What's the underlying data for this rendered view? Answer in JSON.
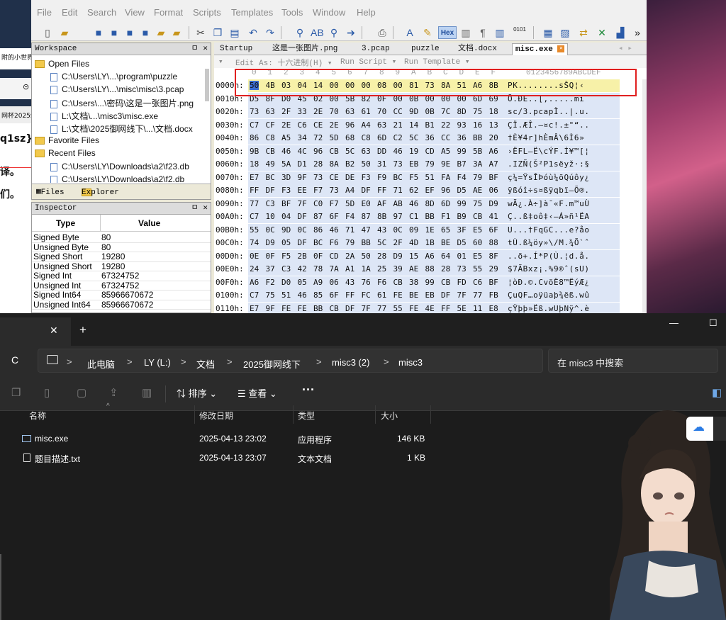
{
  "left_strip": {
    "frag1": "附的小世界",
    "frag2": "网杯2025线",
    "frag3": "q1sz}",
    "frag4": "译。",
    "frag5": "们。"
  },
  "editor": {
    "menu": [
      "File",
      "Edit",
      "Search",
      "View",
      "Format",
      "Scripts",
      "Templates",
      "Tools",
      "Window",
      "Help"
    ],
    "hex_label": "Hex",
    "bin_label": "0101",
    "more": "»",
    "workspace": {
      "title": "Workspace",
      "ctrl": "ㅁ ✕",
      "open_files": "Open Files",
      "files": [
        "C:\\Users\\LY\\...\\program\\puzzle",
        "C:\\Users\\LY\\...\\misc\\misc\\3.pcap",
        "C:\\Users\\...\\密码\\这是一张图片.png",
        "L:\\文档\\...\\misc3\\misc.exe",
        "L:\\文档\\2025御网线下\\...\\文档.docx"
      ],
      "favorites": "Favorite Files",
      "recent": "Recent Files",
      "recent_files": [
        "C:\\Users\\LY\\Downloads\\a2\\f23.db",
        "C:\\Users\\LY\\Downloads\\a2\\f2.db"
      ],
      "tab_files": "Files",
      "tab_explorer": "Explorer"
    },
    "inspector": {
      "title": "Inspector",
      "ctrl": "ㅁ ✕",
      "col_type": "Type",
      "col_value": "Value",
      "rows": [
        {
          "type": "Signed Byte",
          "value": "80"
        },
        {
          "type": "Unsigned Byte",
          "value": "80"
        },
        {
          "type": "Signed Short",
          "value": "19280"
        },
        {
          "type": "Unsigned Short",
          "value": "19280"
        },
        {
          "type": "Signed Int",
          "value": "67324752"
        },
        {
          "type": "Unsigned Int",
          "value": "67324752"
        },
        {
          "type": "Signed Int64",
          "value": "85966670672"
        },
        {
          "type": "Unsigned Int64",
          "value": "85966670672"
        }
      ]
    },
    "tabs": [
      {
        "label": "Startup",
        "active": false
      },
      {
        "label": "这是一张图片.png",
        "active": false
      },
      {
        "label": "3.pcap",
        "active": false
      },
      {
        "label": "puzzle",
        "active": false
      },
      {
        "label": "文档.docx",
        "active": false
      },
      {
        "label": "misc.exe",
        "active": true
      }
    ],
    "edit_as": "Edit As: 十六进制(H) ▾",
    "run_script": "Run Script ▾",
    "run_template": "Run Template ▾",
    "col_headers": [
      "0",
      "1",
      "2",
      "3",
      "4",
      "5",
      "6",
      "7",
      "8",
      "9",
      "A",
      "B",
      "C",
      "D",
      "E",
      "F"
    ],
    "ascii_header": "0123456789ABCDEF",
    "rows": [
      {
        "off": "0000h:",
        "bytes": [
          "50",
          "4B",
          "03",
          "04",
          "14",
          "00",
          "00",
          "00",
          "08",
          "00",
          "81",
          "73",
          "8A",
          "51",
          "A6",
          "8B"
        ],
        "ascii": "PK........sŠQ¦‹"
      },
      {
        "off": "0010h:",
        "bytes": [
          "D5",
          "8F",
          "D0",
          "45",
          "02",
          "00",
          "5B",
          "82",
          "0F",
          "00",
          "0B",
          "00",
          "00",
          "00",
          "6D",
          "69"
        ],
        "ascii": "Õ.ÐE..[‚.....mi"
      },
      {
        "off": "0020h:",
        "bytes": [
          "73",
          "63",
          "2F",
          "33",
          "2E",
          "70",
          "63",
          "61",
          "70",
          "CC",
          "9D",
          "0B",
          "7C",
          "8D",
          "75",
          "18"
        ],
        "ascii": "sc/3.pcapÌ..|.u."
      },
      {
        "off": "0030h:",
        "bytes": [
          "C7",
          "CF",
          "2E",
          "C6",
          "CE",
          "2E",
          "96",
          "A4",
          "63",
          "21",
          "14",
          "B1",
          "22",
          "93",
          "16",
          "13"
        ],
        "ascii": "ÇÏ.ÆÎ.–¤c!.±\"“.."
      },
      {
        "off": "0040h:",
        "bytes": [
          "86",
          "C8",
          "A5",
          "34",
          "72",
          "5D",
          "68",
          "C8",
          "6D",
          "C2",
          "5C",
          "36",
          "CC",
          "36",
          "BB",
          "20"
        ],
        "ascii": "†È¥4r]hÈmÂ\\6Ì6» "
      },
      {
        "off": "0050h:",
        "bytes": [
          "9B",
          "CB",
          "46",
          "4C",
          "96",
          "CB",
          "5C",
          "63",
          "DD",
          "46",
          "19",
          "CD",
          "A5",
          "99",
          "5B",
          "A6"
        ],
        "ascii": "›ËFL–Ë\\cÝF.Í¥™[¦"
      },
      {
        "off": "0060h:",
        "bytes": [
          "18",
          "49",
          "5A",
          "D1",
          "28",
          "8A",
          "B2",
          "50",
          "31",
          "73",
          "EB",
          "79",
          "9E",
          "B7",
          "3A",
          "A7"
        ],
        "ascii": ".IZÑ(Š²P1sëyž·:§"
      },
      {
        "off": "0070h:",
        "bytes": [
          "E7",
          "BC",
          "3D",
          "9F",
          "73",
          "CE",
          "DE",
          "F3",
          "F9",
          "BC",
          "F5",
          "51",
          "FA",
          "F4",
          "79",
          "BF"
        ],
        "ascii": "ç¼=ŸsÎÞóù¼õQúôy¿"
      },
      {
        "off": "0080h:",
        "bytes": [
          "FF",
          "DF",
          "F3",
          "EE",
          "F7",
          "73",
          "A4",
          "DF",
          "FF",
          "71",
          "62",
          "EF",
          "96",
          "D5",
          "AE",
          "06"
        ],
        "ascii": "ÿßóî÷s¤ßÿqbï–Õ®."
      },
      {
        "off": "0090h:",
        "bytes": [
          "77",
          "C3",
          "BF",
          "7F",
          "C0",
          "F7",
          "5D",
          "E0",
          "AF",
          "AB",
          "46",
          "8D",
          "6D",
          "99",
          "75",
          "D9"
        ],
        "ascii": "wÃ¿.À÷]à¯«F.m™uÙ"
      },
      {
        "off": "00A0h:",
        "bytes": [
          "C7",
          "10",
          "04",
          "DF",
          "87",
          "6F",
          "F4",
          "87",
          "8B",
          "97",
          "C1",
          "BB",
          "F1",
          "B9",
          "CB",
          "41"
        ],
        "ascii": "Ç..ß‡oô‡‹—Á»ñ¹ËA"
      },
      {
        "off": "00B0h:",
        "bytes": [
          "55",
          "0C",
          "9D",
          "0C",
          "86",
          "46",
          "71",
          "47",
          "43",
          "0C",
          "09",
          "1E",
          "65",
          "3F",
          "E5",
          "6F"
        ],
        "ascii": "U...†FqGC...e?åo"
      },
      {
        "off": "00C0h:",
        "bytes": [
          "74",
          "D9",
          "05",
          "DF",
          "BC",
          "F6",
          "79",
          "BB",
          "5C",
          "2F",
          "4D",
          "1B",
          "BE",
          "D5",
          "60",
          "88"
        ],
        "ascii": "tÙ.ß¼öy»\\/M.¾Õ`ˆ"
      },
      {
        "off": "00D0h:",
        "bytes": [
          "0E",
          "0F",
          "F5",
          "2B",
          "0F",
          "CD",
          "2A",
          "50",
          "28",
          "D9",
          "15",
          "A6",
          "64",
          "01",
          "E5",
          "8F"
        ],
        "ascii": "..õ+.Í*P(Ù.¦d.å."
      },
      {
        "off": "00E0h:",
        "bytes": [
          "24",
          "37",
          "C3",
          "42",
          "78",
          "7A",
          "A1",
          "1A",
          "25",
          "39",
          "AE",
          "88",
          "28",
          "73",
          "55",
          "29"
        ],
        "ascii": "$7ÃBxz¡.%9®ˆ(sU)"
      },
      {
        "off": "00F0h:",
        "bytes": [
          "A6",
          "F2",
          "D0",
          "05",
          "A9",
          "06",
          "43",
          "76",
          "F6",
          "CB",
          "38",
          "99",
          "CB",
          "FD",
          "C6",
          "BF"
        ],
        "ascii": "¦òÐ.©.CvöË8™ËýÆ¿"
      },
      {
        "off": "0100h:",
        "bytes": [
          "C7",
          "75",
          "51",
          "46",
          "85",
          "6F",
          "FF",
          "FC",
          "61",
          "FE",
          "BE",
          "EB",
          "DF",
          "7F",
          "77",
          "FB"
        ],
        "ascii": "ÇuQF…oÿüaþ¾ëß.wû"
      },
      {
        "off": "0110h:",
        "bytes": [
          "E7",
          "9F",
          "FE",
          "FE",
          "BB",
          "CB",
          "DF",
          "7F",
          "77",
          "55",
          "FE",
          "4E",
          "FF",
          "5E",
          "11",
          "E8"
        ],
        "ascii": "çŸþþ»Ëß.wUþNÿ^.è"
      },
      {
        "off": "0120h:",
        "bytes": [
          "9D",
          "AC",
          "73",
          "81",
          "ED",
          "DE",
          "76",
          "33",
          "84",
          "C0",
          "F7",
          "F1",
          "9B",
          "22",
          "4D",
          "91"
        ],
        "ascii": ".¬s.íÞv3„À÷ñ›\"M‘"
      },
      {
        "off": "0130h:",
        "bytes": [
          "49",
          "02",
          "9B",
          "57",
          "7A",
          "D0",
          "60",
          "B8",
          "E7",
          "D1",
          "3C",
          "03",
          "C5",
          "A1",
          "48",
          "97"
        ],
        "ascii": "I.›WzÐ`¸çÑ<.Å¡H—"
      },
      {
        "off": "0140h:",
        "bytes": [
          "EB",
          "FB",
          "BC",
          "51",
          "5C",
          "69",
          "DA",
          "08",
          "BF",
          "50",
          "53",
          "9D",
          "C8",
          "5D",
          "D3",
          "0C"
        ],
        "ascii": "ëû¼Q\\iÚ.¿PS.È]Ó."
      }
    ]
  },
  "explorer": {
    "close": "✕",
    "add": "+",
    "minimize": "—",
    "maximize": "☐",
    "refresh": "C",
    "breadcrumb": [
      "此电脑",
      "LY (L:)",
      "文档",
      "2025御网线下",
      "misc3 (2)",
      "misc3"
    ],
    "search_placeholder": "在 misc3 中搜索",
    "sort": "排序",
    "view": "查看",
    "more": "···",
    "columns": {
      "name": "名称",
      "date": "修改日期",
      "type": "类型",
      "size": "大小"
    },
    "files": [
      {
        "name": "misc.exe",
        "date": "2025-04-13 23:02",
        "type": "应用程序",
        "size": "146 KB",
        "icon": "exe-icon"
      },
      {
        "name": "题目描述.txt",
        "date": "2025-04-13 23:07",
        "type": "文本文档",
        "size": "1 KB",
        "icon": "txt-icon"
      }
    ]
  }
}
